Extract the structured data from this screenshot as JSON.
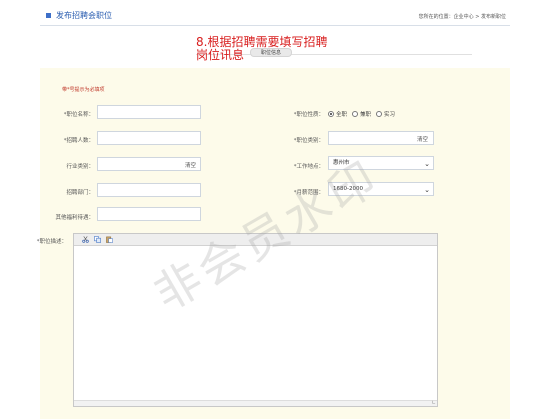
{
  "header": {
    "title": "发布招聘会职位",
    "breadcrumb": "您所在的位置：企业中心 > 发布新职位"
  },
  "overlay_instruction": [
    "8.根据招聘需要填写招聘",
    "岗位讯息"
  ],
  "section_tab": "职位信息",
  "required_note": "带*号提示为必填项",
  "form": {
    "job_name_label": "*职位名称：",
    "headcount_label": "*招聘人数：",
    "industry_label": "行业类别：",
    "department_label": "招聘部门：",
    "other_benefits_label": "其他福利待遇：",
    "job_nature_label": "*职位性质：",
    "job_nature_options": [
      "全职",
      "兼职",
      "实习"
    ],
    "job_nature_selected": "全职",
    "job_category_label": "*职位类别：",
    "work_location_label": "*工作地点：",
    "work_location_value": "惠州市",
    "salary_label": "*月薪范围：",
    "salary_value": "1680-2000",
    "clear_label": "清空",
    "description_label": "*职位描述："
  },
  "editor_tools": [
    "cut-icon",
    "copy-icon",
    "paste-icon"
  ],
  "watermark": "非会员水印"
}
